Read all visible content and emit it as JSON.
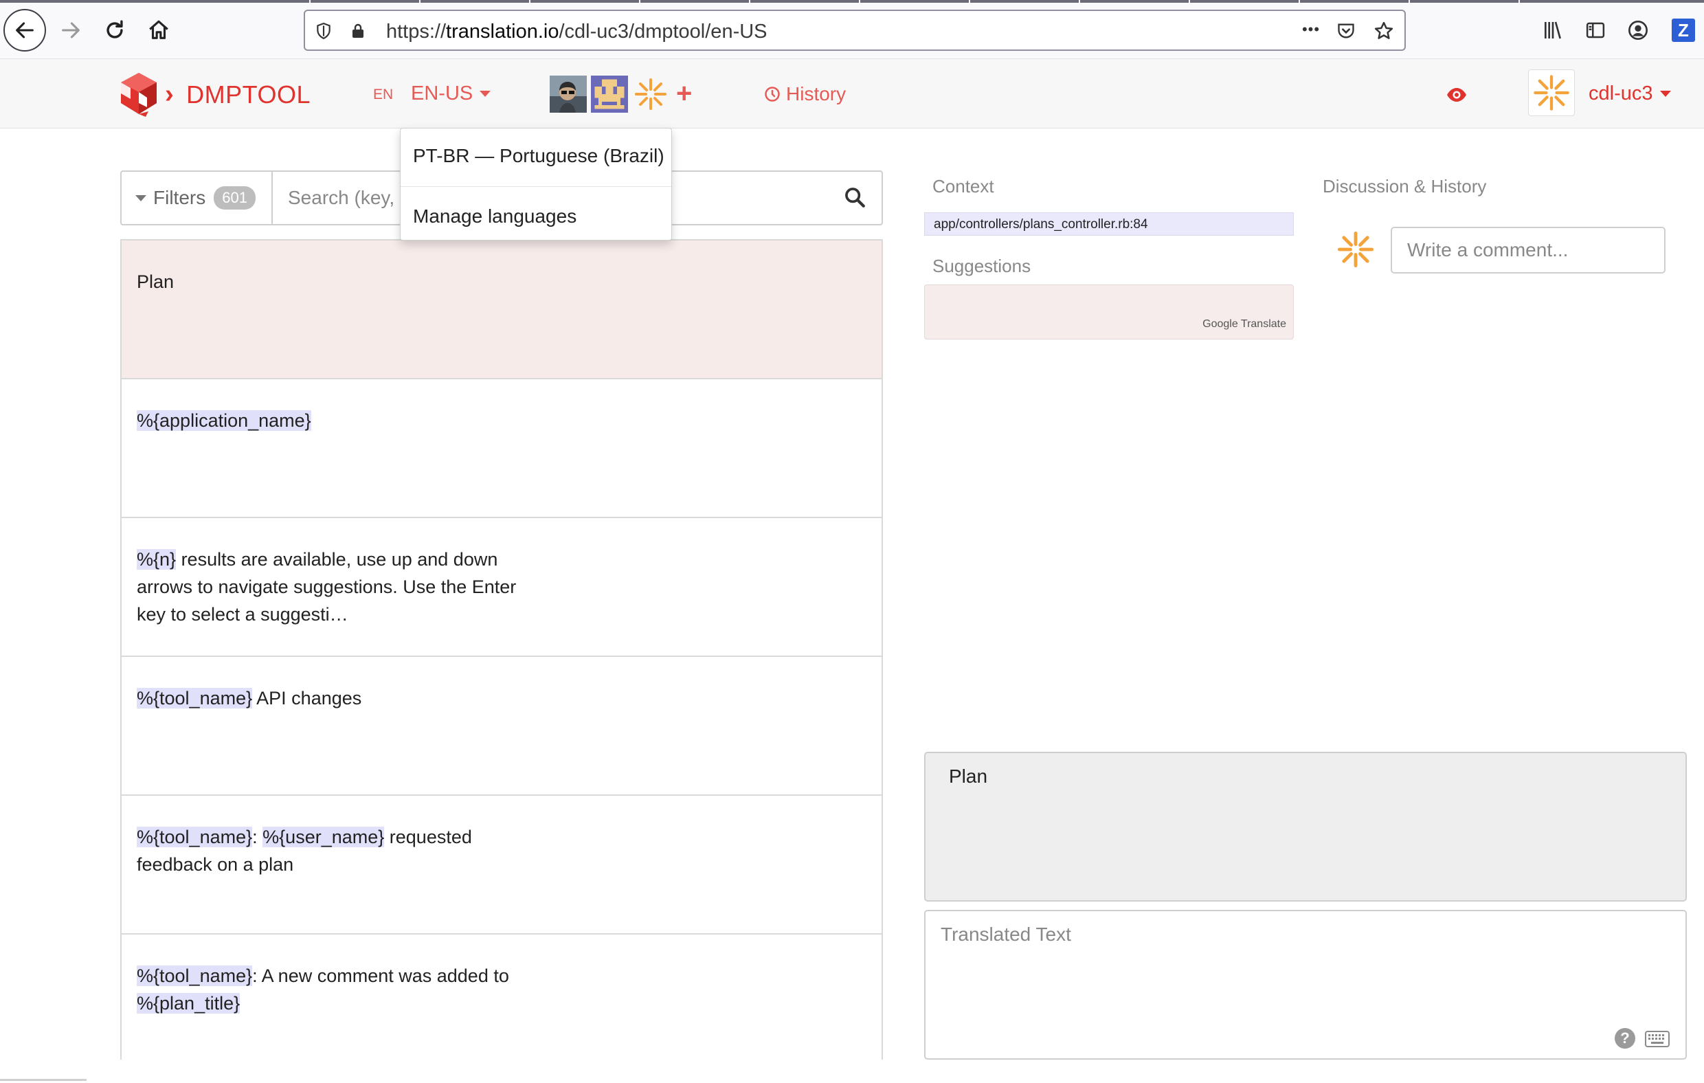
{
  "browser": {
    "url_prefix": "https://",
    "url_domain": "translation.io",
    "url_path": "/cdl-uc3/dmptool/en-US",
    "more_label": "•••",
    "extension_letter": "Z"
  },
  "header": {
    "brand": "DMPTOOL",
    "source_language": "EN",
    "target_language": "EN-US",
    "add_collaborator": "+",
    "history_label": "History",
    "user_name": "cdl-uc3"
  },
  "language_menu": {
    "items": [
      {
        "label": "PT-BR — Portuguese (Brazil)"
      },
      {
        "label": "Manage languages"
      }
    ]
  },
  "filters": {
    "label": "Filters",
    "count": "601",
    "search_placeholder": "Search (key, source or translation)"
  },
  "keys": [
    {
      "segments": [
        {
          "t": "Plan"
        }
      ]
    },
    {
      "segments": [
        {
          "t": "%{application_name}",
          "ph": true
        }
      ]
    },
    {
      "segments": [
        {
          "t": "%{n}",
          "ph": true
        },
        {
          "t": " results are available, use up and down arrows to navigate suggestions. Use the Enter key to select a suggesti…"
        }
      ]
    },
    {
      "segments": [
        {
          "t": "%{tool_name}",
          "ph": true
        },
        {
          "t": " API changes"
        }
      ]
    },
    {
      "segments": [
        {
          "t": "%{tool_name}",
          "ph": true
        },
        {
          "t": ": "
        },
        {
          "t": "%{user_name}",
          "ph": true
        },
        {
          "t": " requested feedback on a plan"
        }
      ]
    },
    {
      "segments": [
        {
          "t": "%{tool_name}",
          "ph": true
        },
        {
          "t": ": A new comment was added to "
        },
        {
          "t": "%{plan_title}",
          "ph": true
        }
      ]
    }
  ],
  "context": {
    "label": "Context",
    "path": "app/controllers/plans_controller.rb:84",
    "suggestions_label": "Suggestions",
    "google_credit": "Google Translate"
  },
  "discussion": {
    "label": "Discussion & History",
    "comment_placeholder": "Write a comment..."
  },
  "editor": {
    "source_text": "Plan",
    "translation_placeholder": "Translated Text",
    "help_label": "?"
  },
  "colors": {
    "accent": "#e0332e",
    "accent_light": "#e65a55",
    "active_row": "#f7ebea",
    "placeholder_highlight": "#e0e0fb"
  }
}
